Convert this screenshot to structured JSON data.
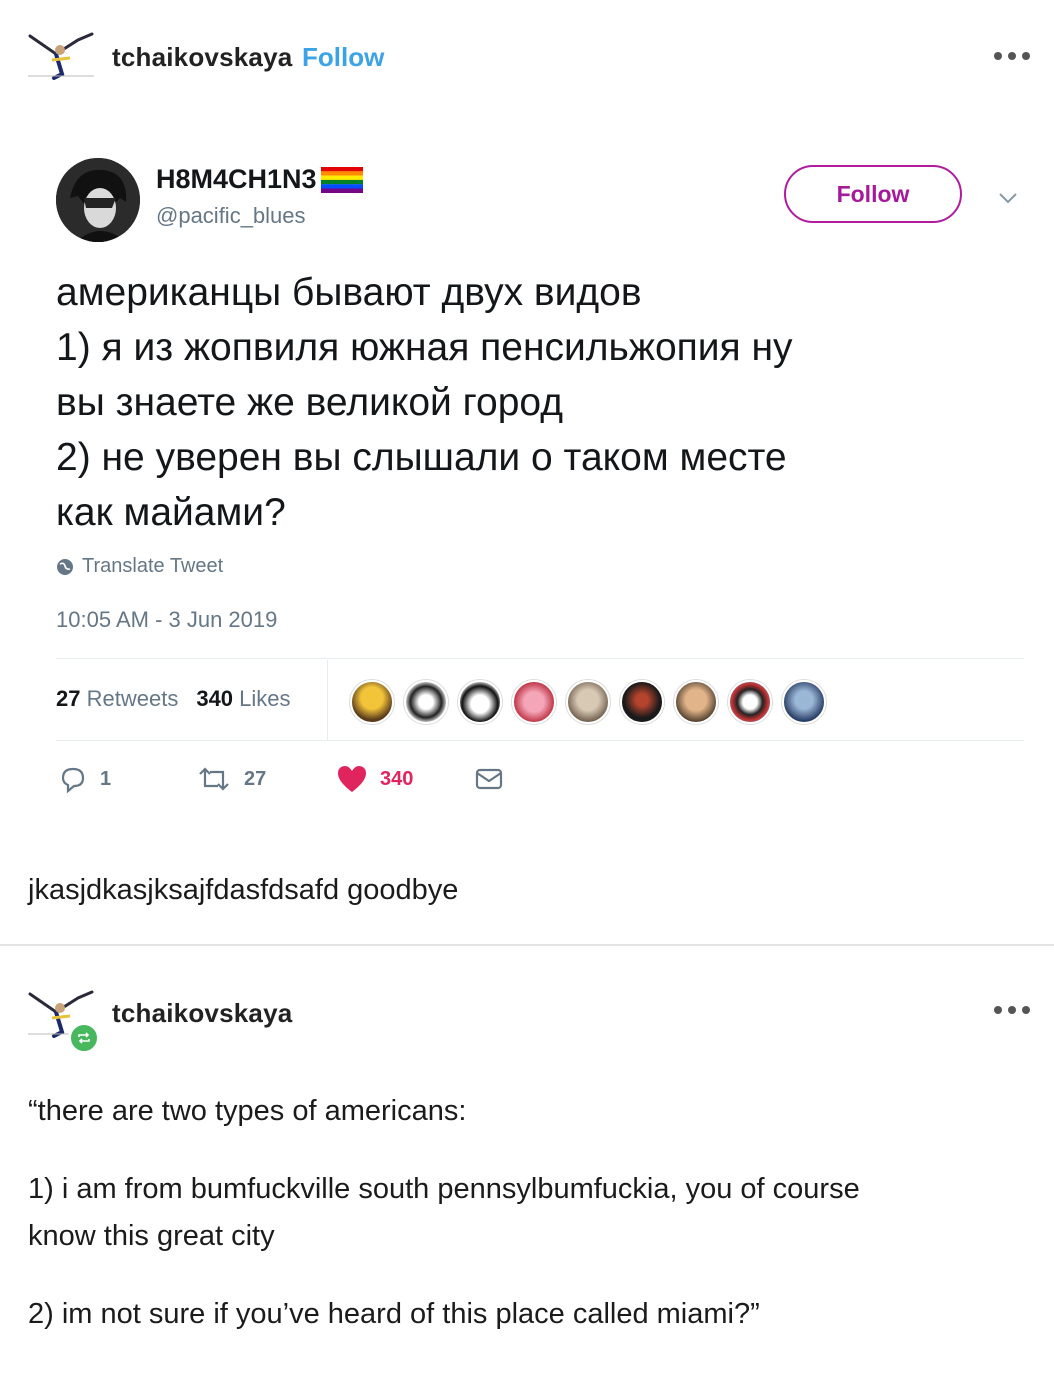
{
  "post1": {
    "username": "tchaikovskaya",
    "follow_label": "Follow"
  },
  "tweet": {
    "display_name": "H8M4CH1N3",
    "handle": "@pacific_blues",
    "follow_label": "Follow",
    "body_lines": [
      "американцы бывают двух видов",
      "1) я из жопвиля южная пенсильжопия ну",
      "вы знаете же великой город",
      "2) не уверен вы слышали о таком месте",
      "как майами?"
    ],
    "translate_label": "Translate Tweet",
    "timestamp": "10:05 AM - 3 Jun 2019",
    "retweets_count": "27",
    "retweets_label": "Retweets",
    "likes_count": "340",
    "likes_label": "Likes",
    "reply_count": "1",
    "retweet_action_count": "27",
    "like_action_count": "340",
    "colors": {
      "accent": "#a5199b",
      "like": "#e0245e",
      "text_secondary": "#657786"
    }
  },
  "post1_caption": "jkasjdkasjksajfdasfdsafd goodbye",
  "post2": {
    "username": "tchaikovskaya",
    "paragraphs": [
      "“there are two types of americans:",
      "1) i am from bumfuckville south pennsylbumfuckia, you of course",
      "know this great city",
      "2) im not sure if you’ve heard of this place called miami?”"
    ]
  }
}
